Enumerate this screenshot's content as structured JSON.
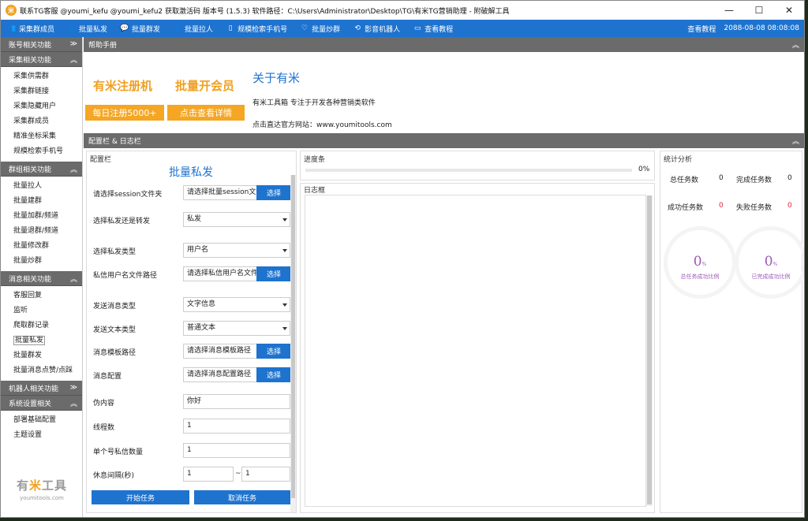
{
  "window": {
    "logo_char": "米",
    "title": "联系TG客服 @youmi_kefu @youmi_kefu2 获取激活码 版本号 (1.5.3) 软件路径：C:\\Users\\Administrator\\Desktop\\TG\\有米TG营销助理 - 附破解工具",
    "minimize": "—",
    "maximize": "☐",
    "close": "✕"
  },
  "topnav": {
    "items": [
      {
        "label": "采集群成员",
        "icon": "users-icon",
        "glyph": "👥"
      },
      {
        "label": "批量私发",
        "icon": "user-plus-icon",
        "glyph": "👤"
      },
      {
        "label": "批量群发",
        "icon": "chat-bubble-icon",
        "glyph": "💬"
      },
      {
        "label": "批量拉人",
        "icon": "user-icon",
        "glyph": "👤"
      },
      {
        "label": "规模检索手机号",
        "icon": "phone-icon",
        "glyph": "▯"
      },
      {
        "label": "批量炒群",
        "icon": "heart-icon",
        "glyph": "♡"
      },
      {
        "label": "影音机器人",
        "icon": "loop-icon",
        "glyph": "⟲"
      },
      {
        "label": "查看教程",
        "icon": "monitor-icon",
        "glyph": "▭"
      }
    ],
    "right_link": "查看教程",
    "datetime": "2088-08-08 08:08:08"
  },
  "sidebar": {
    "groups": [
      {
        "title": "账号相关功能",
        "arrow": "≫",
        "items": []
      },
      {
        "title": "采集相关功能",
        "arrow": "︽",
        "items": [
          "采集供需群",
          "采集群链接",
          "采集隐藏用户",
          "采集群成员",
          "精准坐标采集",
          "规模检索手机号"
        ]
      },
      {
        "title": "群组相关功能",
        "arrow": "︽",
        "items": [
          "批量拉人",
          "批量建群",
          "批量加群/频道",
          "批量退群/频道",
          "批量修改群",
          "批量炒群"
        ]
      },
      {
        "title": "消息相关功能",
        "arrow": "︽",
        "items": [
          "客服回复",
          "监听",
          "爬取群记录",
          "批量私发",
          "批量群发",
          "批量消息点赞/点踩"
        ]
      },
      {
        "title": "机器人相关功能",
        "arrow": "≫",
        "items": []
      },
      {
        "title": "系统设置相关",
        "arrow": "︽",
        "items": [
          "部署基础配置",
          "主题设置"
        ]
      }
    ],
    "active_item": "批量私发",
    "logo_a": "有",
    "logo_b": "米",
    "logo_c": "工具",
    "logo_site": "youmitools.com"
  },
  "help": {
    "header": "帮助手册",
    "arrow": "︽",
    "promo1_title": "有米注册机",
    "promo1_btn": "每日注册5000+",
    "promo2_title": "批量开会员",
    "promo2_btn": "点击查看详情",
    "about_title": "关于有米",
    "about_desc": "有米工具箱 专注于开发各种营销类软件",
    "about_site": "点击直达官方网站：www.youmitools.com"
  },
  "config_section": {
    "header": "配置栏 & 日志栏",
    "arrow": "︽"
  },
  "config": {
    "panel_label": "配置栏",
    "heading": "批量私发",
    "session_label": "请选择session文件夹",
    "session_value": "请选择批量session文件夹",
    "session_btn": "选择",
    "mode_label": "选择私发还是转发",
    "mode_value": "私发",
    "type_label": "选择私发类型",
    "type_value": "用户名",
    "userfile_label": "私信用户名文件路径",
    "userfile_value": "请选择私信用户名文件路径",
    "userfile_btn": "选择",
    "msgtype_label": "发送消息类型",
    "msgtype_value": "文字信息",
    "texttype_label": "发送文本类型",
    "texttype_value": "普通文本",
    "template_label": "消息模板路径",
    "template_value": "请选择消息模板路径",
    "template_btn": "选择",
    "msgcfg_label": "消息配置",
    "msgcfg_value": "请选择消息配置路径",
    "msgcfg_btn": "选择",
    "fake_label": "伪内容",
    "fake_value": "你好",
    "threads_label": "线程数",
    "threads_value": "1",
    "per_label": "单个号私信数量",
    "per_value": "1",
    "interval_label": "休息间隔(秒)",
    "interval_min": "1",
    "interval_sep": "~",
    "interval_max": "1",
    "start_btn": "开始任务",
    "cancel_btn": "取消任务"
  },
  "progress": {
    "label": "进度条",
    "value": 0,
    "pct_text": "0%"
  },
  "log": {
    "label": "日志框"
  },
  "stats": {
    "label": "统计分析",
    "total_label": "总任务数",
    "total_value": "0",
    "done_label": "完成任务数",
    "done_value": "0",
    "success_label": "成功任务数",
    "success_value": "0",
    "fail_label": "失败任务数",
    "fail_value": "0",
    "ring1_value": "0",
    "ring1_unit": "%",
    "ring1_caption": "总任务成功比例",
    "ring2_value": "0",
    "ring2_unit": "%",
    "ring2_caption": "已完成成功比例"
  },
  "colors": {
    "accent": "#1e73cf",
    "promo": "#f0a020",
    "header_gray": "#6b6b6b",
    "stat_red": "#e0263a",
    "ring_purple": "#9b59b6"
  }
}
